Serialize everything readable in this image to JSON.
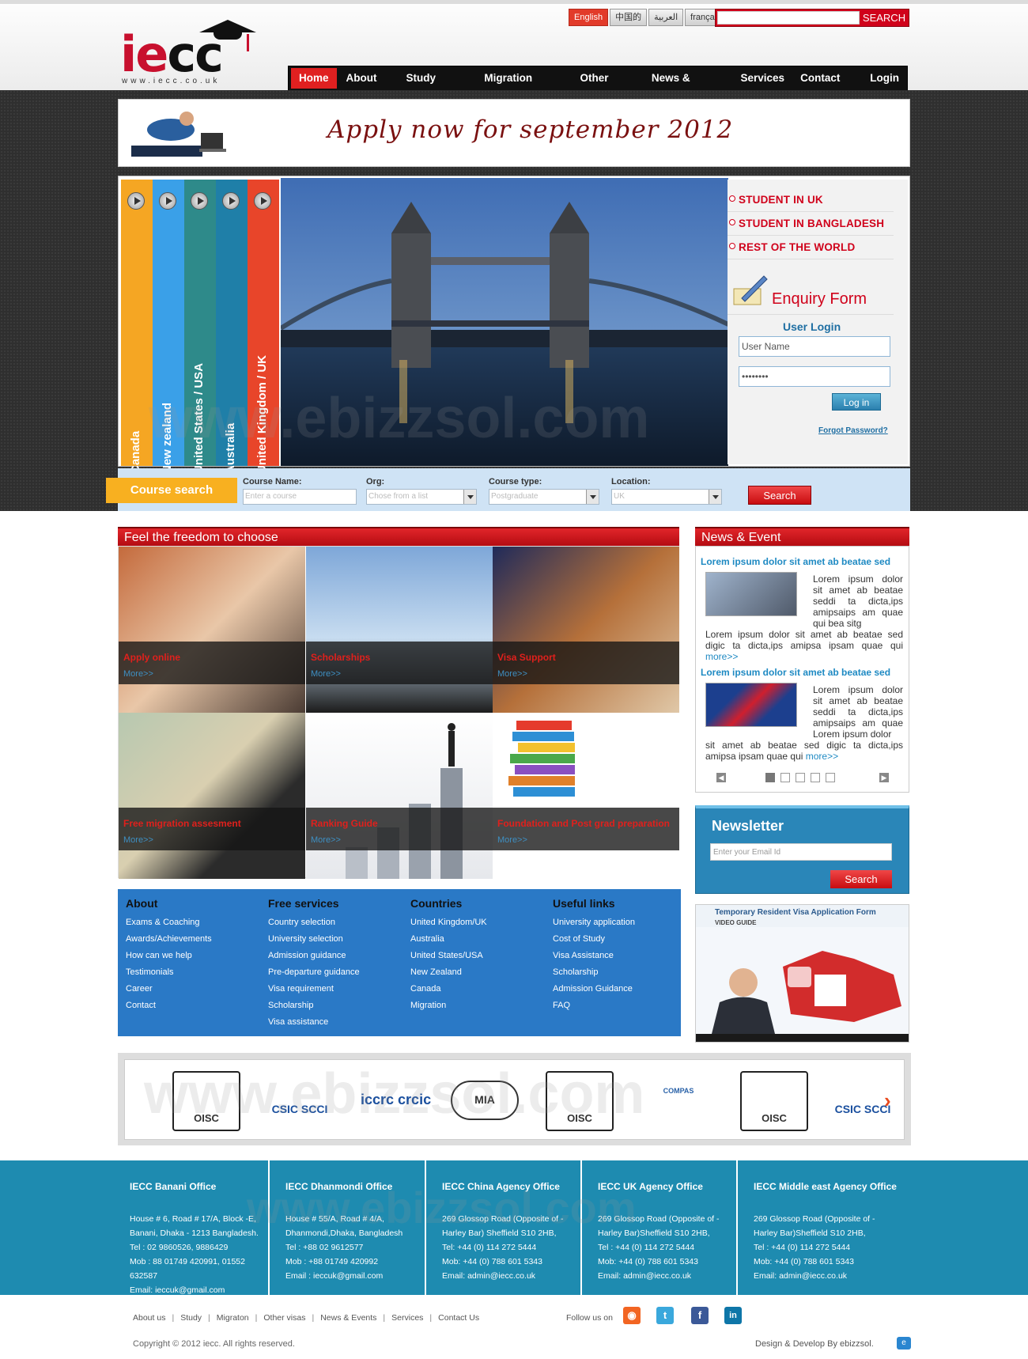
{
  "brand": {
    "logo_text_red": "ie",
    "logo_text_dark": "cc",
    "logo_url": "www.iecc.co.uk"
  },
  "languages": [
    "English",
    "中国的",
    "العربية",
    "français"
  ],
  "search": {
    "button": "SEARCH",
    "placeholder": ""
  },
  "nav": [
    "Home",
    "About us",
    "Study option",
    "Migration option",
    "Other visas",
    "News & Events",
    "Services",
    "Contact Us",
    "Login"
  ],
  "banner": {
    "tagline": "Apply now for september 2012"
  },
  "slider_tabs": [
    {
      "label": "Canada",
      "color": "#f5a623"
    },
    {
      "label": "New zealand",
      "color": "#3aa0e8"
    },
    {
      "label": "United States / USA",
      "color": "#2e8a8a"
    },
    {
      "label": "Australia",
      "color": "#1f7fa8"
    },
    {
      "label": "United Kingdom / UK",
      "color": "#e8452a"
    }
  ],
  "right_links": [
    "STUDENT IN UK",
    "STUDENT IN BANGLADESH",
    "REST OF THE WORLD"
  ],
  "enquiry": "Enquiry Form",
  "login": {
    "title": "User Login",
    "username": "User Name",
    "password": "••••••••",
    "button": "Log in",
    "forgot": "Forgot Password?"
  },
  "course_search": {
    "title": "Course search",
    "fields": [
      {
        "label": "Course Name:",
        "value": "Enter a course"
      },
      {
        "label": "Org:",
        "value": "Chose from a list"
      },
      {
        "label": "Course type:",
        "value": "Postgraduate"
      },
      {
        "label": "Location:",
        "value": "UK"
      }
    ],
    "button": "Search"
  },
  "freedom": {
    "title": "Feel the freedom to choose",
    "tiles": [
      {
        "title": "Apply online",
        "more": "More>>"
      },
      {
        "title": "Scholarships",
        "more": "More>>"
      },
      {
        "title": "Visa Support",
        "more": "More>>"
      },
      {
        "title": "Free migration assesment",
        "more": "More>>"
      },
      {
        "title": "Ranking Guide",
        "more": "More>>"
      },
      {
        "title": "Foundation and Post grad preparation",
        "more": "More>>"
      }
    ]
  },
  "news": {
    "title": "News & Event",
    "items": [
      {
        "headline": "Lorem ipsum dolor sit amet ab beatae sed",
        "side": "Lorem ipsum dolor sit amet ab beatae seddi ta dicta,ips amipsaips am quae qui bea sitg",
        "body": "Lorem ipsum dolor sit amet ab beatae sed digic ta dicta,ips amipsa ipsam quae qui",
        "more": "more>>"
      },
      {
        "headline": "Lorem ipsum dolor sit amet ab beatae sed",
        "side": "Lorem ipsum dolor sit amet ab beatae seddi ta dicta,ips amipsaips am quae Lorem ipsum dolor",
        "body": "sit amet ab beatae sed digic ta dicta,ips amipsa ipsam quae qui",
        "more": "more>>"
      }
    ]
  },
  "newsletter": {
    "title": "Newsletter",
    "placeholder": "Enter your Email Id",
    "button": "Search"
  },
  "video": {
    "title": "Temporary Resident Visa Application Form",
    "subtitle": "VIDEO GUIDE"
  },
  "link_columns": [
    {
      "title": "About",
      "items": [
        "Exams & Coaching",
        "Awards/Achievements",
        "How can we help",
        "Testimonials",
        "Career",
        "Contact"
      ]
    },
    {
      "title": "Free services",
      "items": [
        "Country selection",
        "University selection",
        "Admission guidance",
        "Pre-departure guidance",
        "Visa requirement",
        "Scholarship",
        "Visa assistance"
      ]
    },
    {
      "title": "Countries",
      "items": [
        "United Kingdom/UK",
        "Australia",
        "United States/USA",
        "New Zealand",
        "Canada",
        "Migration"
      ]
    },
    {
      "title": "Useful links",
      "items": [
        "University application",
        "Cost of Study",
        "Visa Assistance",
        "Scholarship",
        "Admission Guidance",
        "FAQ"
      ]
    }
  ],
  "partners": [
    "OISC",
    "CSIC SCCI",
    "iccrc crcic",
    "MIA",
    "OISC",
    "COMPAS",
    "OISC",
    "CSIC SCCI"
  ],
  "offices": [
    {
      "title": "IECC Banani Office",
      "lines": [
        "House # 6, Road # 17/A, Block -E,",
        "Banani, Dhaka - 1213 Bangladesh.",
        "Tel : 02 9860526, 9886429",
        "Mob : 88 01749 420991, 01552",
        "632587",
        "Email: ieccuk@gmail.com"
      ]
    },
    {
      "title": "IECC Dhanmondi Office",
      "lines": [
        "House # 55/A, Road # 4/A,",
        "Dhanmondi,Dhaka, Bangladesh",
        "Tel : +88 02 9612577",
        "Mob : +88 01749 420992",
        "Email : ieccuk@gmail.com"
      ]
    },
    {
      "title": "IECC China Agency Office",
      "lines": [
        "269 Glossop Road (Opposite of -",
        "Harley Bar) Sheffield S10 2HB,",
        "Tel: +44 (0) 114 272 5444",
        "Mob: +44 (0) 788 601 5343",
        "Email: admin@iecc.co.uk"
      ]
    },
    {
      "title": "IECC UK Agency Office",
      "lines": [
        "269 Glossop Road (Opposite of -",
        "Harley Bar)Sheffield S10 2HB,",
        "Tel : +44 (0) 114 272 5444",
        "Mob: +44 (0) 788 601 5343",
        "Email: admin@iecc.co.uk"
      ]
    },
    {
      "title": "IECC Middle east Agency Office",
      "lines": [
        "269 Glossop Road (Opposite of -",
        "Harley Bar)Sheffield S10 2HB,",
        "Tel : +44 (0) 114 272 5444",
        "Mob: +44 (0) 788 601 5343",
        "Email: admin@iecc.co.uk"
      ]
    }
  ],
  "footer_nav": [
    "About us",
    "Study",
    "Migraton",
    "Other visas",
    "News & Events",
    "Services",
    "Contact Us"
  ],
  "follow": "Follow us on",
  "social": [
    {
      "name": "rss-icon",
      "glyph": "◉",
      "color": "#f26522"
    },
    {
      "name": "twitter-icon",
      "glyph": "t",
      "color": "#3aa8dc"
    },
    {
      "name": "facebook-icon",
      "glyph": "f",
      "color": "#3b5998"
    },
    {
      "name": "linkedin-icon",
      "glyph": "in",
      "color": "#0e76a8"
    }
  ],
  "copyright": "Copyright © 2012 iecc. All rights reserved.",
  "developer": "Design & Develop By ebizzsol.",
  "watermark": "www.ebizzsol.com"
}
